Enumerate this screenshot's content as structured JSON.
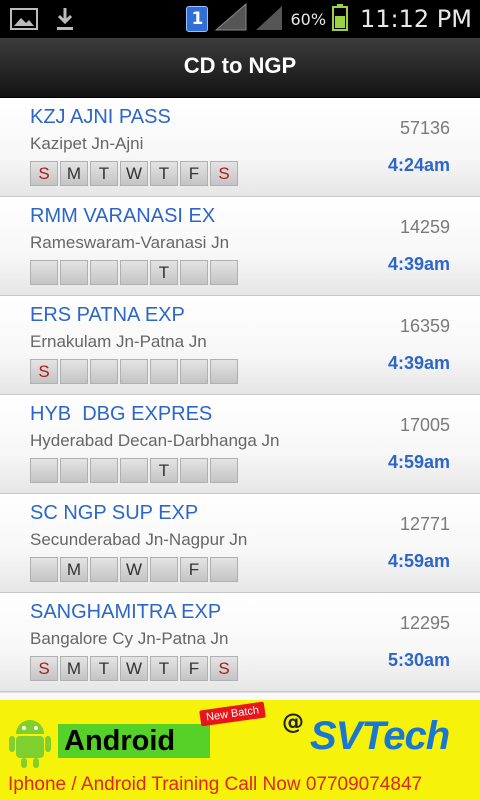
{
  "status_bar": {
    "icons": [
      "image-icon",
      "download-icon",
      "notification-badge-icon",
      "signal-icon",
      "signal-icon",
      "battery-icon"
    ],
    "notification_count": "1",
    "battery": "60%",
    "time": "11:12 PM"
  },
  "header": {
    "title": "CD to NGP"
  },
  "trains": [
    {
      "name": "KZJ AJNI PASS",
      "route": "Kazipet Jn-Ajni",
      "number": "57136",
      "time": "4:24am",
      "days": [
        "S",
        "M",
        "T",
        "W",
        "T",
        "F",
        "S"
      ]
    },
    {
      "name": "RMM VARANASI EX",
      "route": "Rameswaram-Varanasi Jn",
      "number": "14259",
      "time": "4:39am",
      "days": [
        "",
        "",
        "",
        "",
        "T",
        "",
        ""
      ]
    },
    {
      "name": "ERS PATNA EXP",
      "route": "Ernakulam Jn-Patna Jn",
      "number": "16359",
      "time": "4:39am",
      "days": [
        "S",
        "",
        "",
        "",
        "",
        "",
        ""
      ]
    },
    {
      "name": "HYB  DBG EXPRES",
      "route": "Hyderabad Decan-Darbhanga Jn",
      "number": "17005",
      "time": "4:59am",
      "days": [
        "",
        "",
        "",
        "",
        "T",
        "",
        ""
      ]
    },
    {
      "name": "SC NGP SUP EXP",
      "route": "Secunderabad Jn-Nagpur Jn",
      "number": "12771",
      "time": "4:59am",
      "days": [
        "",
        "M",
        "",
        "W",
        "",
        "F",
        ""
      ]
    },
    {
      "name": "SANGHAMITRA EXP",
      "route": "Bangalore Cy Jn-Patna Jn",
      "number": "12295",
      "time": "5:30am",
      "days": [
        "S",
        "M",
        "T",
        "W",
        "T",
        "F",
        "S"
      ]
    }
  ],
  "ad": {
    "android_label": "Android",
    "new_batch": "New Batch",
    "at": "@",
    "brand": "SVTech",
    "text": "Iphone / Android Training Call Now 07709074847"
  },
  "colors": {
    "accent": "#2c66c8",
    "sunday": "#b01818",
    "ad_bg": "#f6f20a",
    "ad_text": "#e0251d"
  }
}
